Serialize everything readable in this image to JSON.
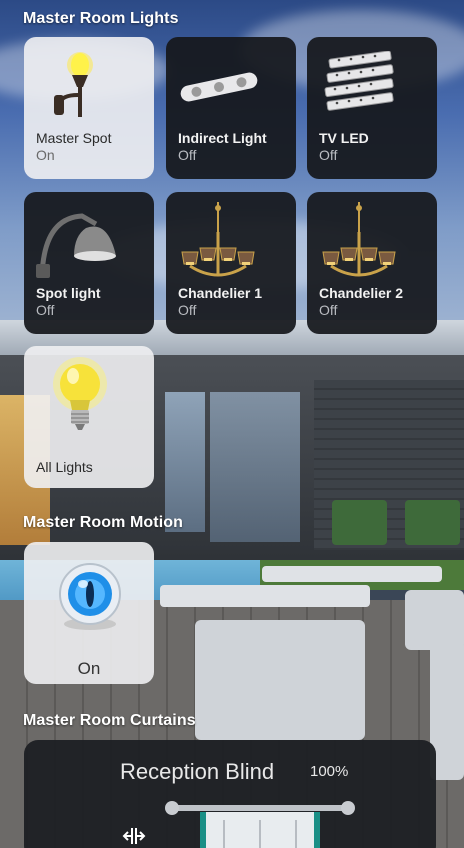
{
  "sections": {
    "lights_title": "Master Room Lights",
    "motion_title": "Master Room Motion",
    "curtains_title": "Master Room Curtains"
  },
  "lights": [
    {
      "name": "Master Spot",
      "state": "On",
      "icon": "wall-torch-lamp-icon"
    },
    {
      "name": "Indirect Light",
      "state": "Off",
      "icon": "ceiling-spot-bar-icon"
    },
    {
      "name": "TV LED",
      "state": "Off",
      "icon": "led-strip-icon"
    },
    {
      "name": "Spot light",
      "state": "Off",
      "icon": "wall-spot-lamp-icon"
    },
    {
      "name": "Chandelier 1",
      "state": "Off",
      "icon": "chandelier-icon"
    },
    {
      "name": "Chandelier 2",
      "state": "Off",
      "icon": "chandelier-icon"
    }
  ],
  "all_lights": {
    "name": "All Lights",
    "icon": "light-bulb-icon"
  },
  "motion": {
    "state": "On",
    "icon": "motion-sensor-eye-icon"
  },
  "curtain": {
    "name": "Reception Blind",
    "level": "100%",
    "icon": "curtain-rod-icon"
  },
  "colors": {
    "accent_on": "#f4e23a",
    "tile_dark": "#16181c",
    "tile_light": "#f0f0f2"
  }
}
